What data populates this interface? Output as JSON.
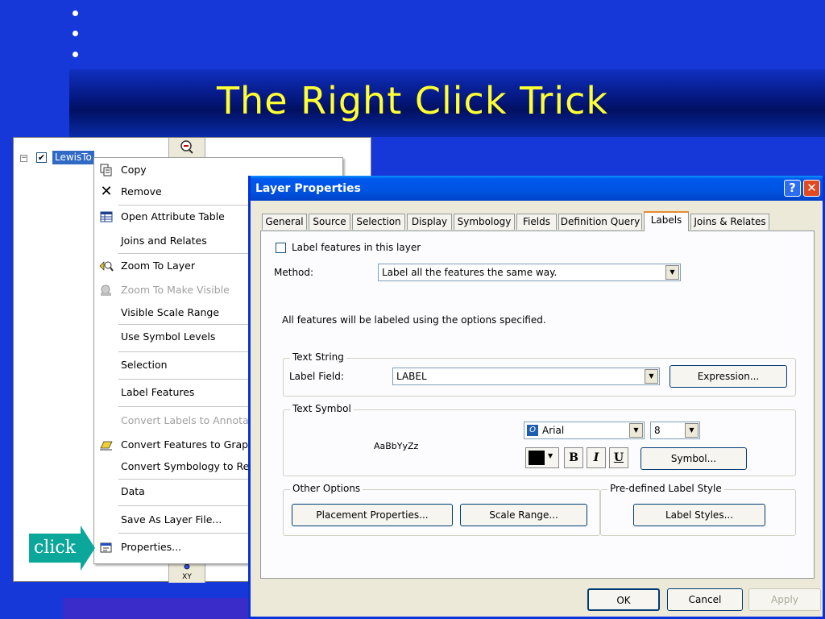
{
  "slide": {
    "title": "The Right Click Trick",
    "callout": "click"
  },
  "toc": {
    "layer_name": "LewisTo"
  },
  "context_menu": {
    "items": [
      {
        "label": "Copy",
        "icon": "copy-icon",
        "enabled": true
      },
      {
        "label": "Remove",
        "icon": "remove-icon",
        "enabled": true
      },
      {
        "label": "Open Attribute Table",
        "icon": "table-icon",
        "enabled": true
      },
      {
        "label": "Joins and Relates",
        "icon": "",
        "enabled": true
      },
      {
        "label": "Zoom To Layer",
        "icon": "zoom-to-layer-icon",
        "enabled": true
      },
      {
        "label": "Zoom To Make Visible",
        "icon": "zoom-visible-icon",
        "enabled": false
      },
      {
        "label": "Visible Scale Range",
        "icon": "",
        "enabled": true
      },
      {
        "label": "Use Symbol Levels",
        "icon": "",
        "enabled": true
      },
      {
        "label": "Selection",
        "icon": "",
        "enabled": true
      },
      {
        "label": "Label Features",
        "icon": "",
        "enabled": true
      },
      {
        "label": "Convert Labels to Annotati",
        "icon": "",
        "enabled": false
      },
      {
        "label": "Convert Features to Graph",
        "icon": "convert-features-icon",
        "enabled": true
      },
      {
        "label": "Convert Symbology to Rep",
        "icon": "",
        "enabled": true
      },
      {
        "label": "Data",
        "icon": "",
        "enabled": true
      },
      {
        "label": "Save As Layer File...",
        "icon": "",
        "enabled": true
      },
      {
        "label": "Properties...",
        "icon": "properties-icon",
        "enabled": true
      }
    ]
  },
  "dialog": {
    "title": "Layer Properties",
    "tabs": [
      "General",
      "Source",
      "Selection",
      "Display",
      "Symbology",
      "Fields",
      "Definition Query",
      "Labels",
      "Joins & Relates"
    ],
    "active_tab": "Labels",
    "label_features_checkbox": "Label features in this layer",
    "method_label": "Method:",
    "method_value": "Label all the features the same way.",
    "info_text": "All features will be labeled using the options specified.",
    "text_string": {
      "group_label": "Text String",
      "field_label": "Label Field:",
      "field_value": "LABEL",
      "expression_button": "Expression..."
    },
    "text_symbol": {
      "group_label": "Text Symbol",
      "preview": "AaBbYyZz",
      "font": "Arial",
      "size": "8",
      "color": "#000000",
      "bold": "B",
      "italic": "I",
      "underline": "U",
      "symbol_button": "Symbol..."
    },
    "other_options": {
      "group_label": "Other Options",
      "placement_button": "Placement Properties...",
      "scale_range_button": "Scale Range..."
    },
    "predefined": {
      "group_label": "Pre-defined Label Style",
      "label_styles_button": "Label Styles..."
    },
    "footer": {
      "ok": "OK",
      "cancel": "Cancel",
      "apply": "Apply"
    }
  }
}
